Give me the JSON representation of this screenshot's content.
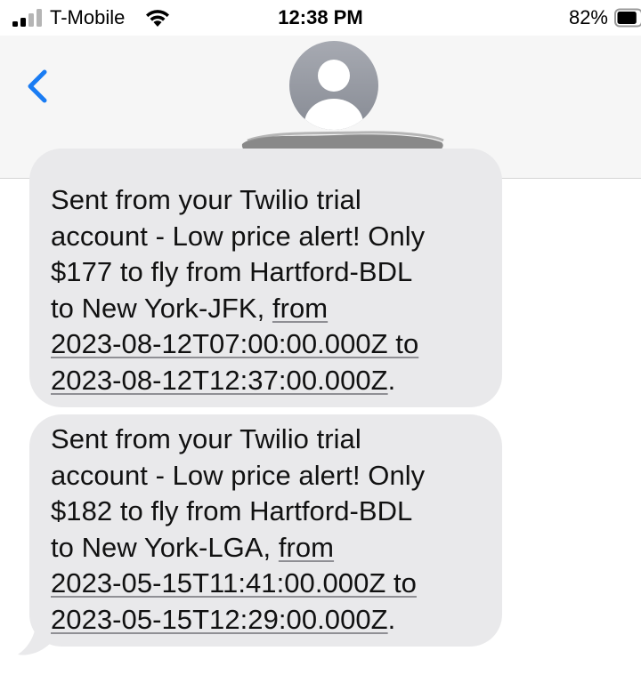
{
  "status_bar": {
    "carrier": "T-Mobile",
    "time": "12:38 PM",
    "battery_percent": "82%",
    "battery_level": 0.82
  },
  "header": {
    "back_icon": "chevron-left-icon",
    "avatar_icon": "person-icon",
    "accent_color": "#1a7cf3"
  },
  "messages": [
    {
      "lines": [
        "Sent from your Twilio trial",
        "account - Low price alert! Only",
        "$177 to fly from Hartford-BDL",
        "to New York-JFK, "
      ],
      "link_from": "from",
      "link_start": "2023-08-12T07:00:00.000Z to",
      "link_end": "2023-08-12T12:37:00.000Z",
      "end_punct": "."
    },
    {
      "lines": [
        "Sent from your Twilio trial",
        "account - Low price alert! Only",
        "$182 to fly from Hartford-BDL",
        "to New York-LGA, "
      ],
      "link_from": "from",
      "link_start": "2023-05-15T11:41:00.000Z to",
      "link_end": "2023-05-15T12:29:00.000Z",
      "end_punct": "."
    }
  ],
  "colors": {
    "bubble_received": "#e9e9eb",
    "header_bg": "#f6f6f6"
  }
}
